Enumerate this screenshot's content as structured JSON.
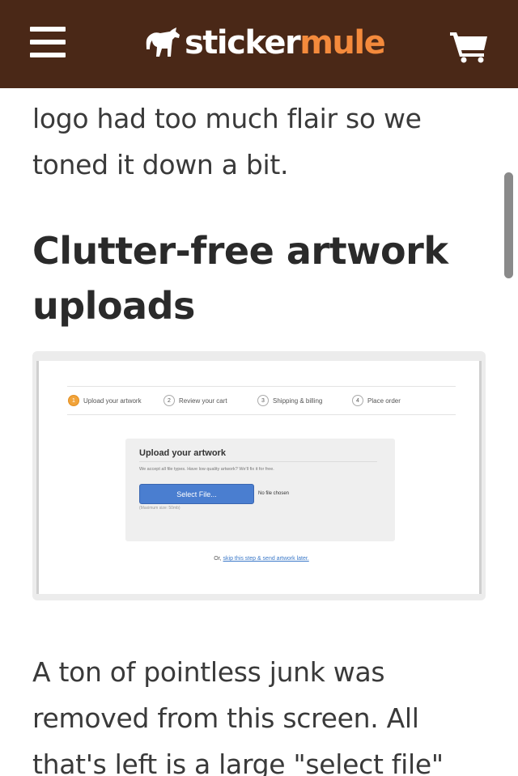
{
  "header": {
    "menu_icon": "hamburger-menu-icon",
    "logo": {
      "word1": "sticker",
      "word2": "mule",
      "icon": "mule-logo-icon",
      "color_word1": "#ffffff",
      "color_word2": "#f48a3c"
    },
    "cart_icon": "shopping-cart-icon",
    "background": "#4a2817"
  },
  "article": {
    "para_top": "logo had too much flair so we toned it down a bit.",
    "heading": "Clutter-free artwork uploads",
    "para_bottom": "A ton of pointless junk was removed from this screen. All that's left is a large \"select file\""
  },
  "screenshot": {
    "steps": [
      {
        "num": "1",
        "label": "Upload your artwork"
      },
      {
        "num": "2",
        "label": "Review your cart"
      },
      {
        "num": "3",
        "label": "Shipping & billing"
      },
      {
        "num": "4",
        "label": "Place order"
      }
    ],
    "upload_title": "Upload your artwork",
    "upload_desc": "We accept all file types. Have low quality artwork? We'll fix it for free.",
    "select_button": "Select File...",
    "no_file": "No file chosen",
    "max_size": "(Maximum size: 50mb)",
    "skip_prefix": "Or,",
    "skip_link": "skip this step & send artwork later."
  }
}
